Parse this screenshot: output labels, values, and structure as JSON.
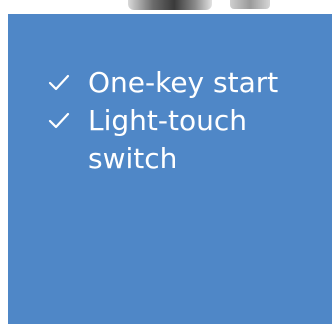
{
  "features": [
    {
      "icon": "check-icon",
      "label": "One-key start"
    },
    {
      "icon": "check-icon",
      "label": "Light-touch switch"
    }
  ],
  "colors": {
    "panel_background": "#4f87c7",
    "text": "#ffffff"
  }
}
